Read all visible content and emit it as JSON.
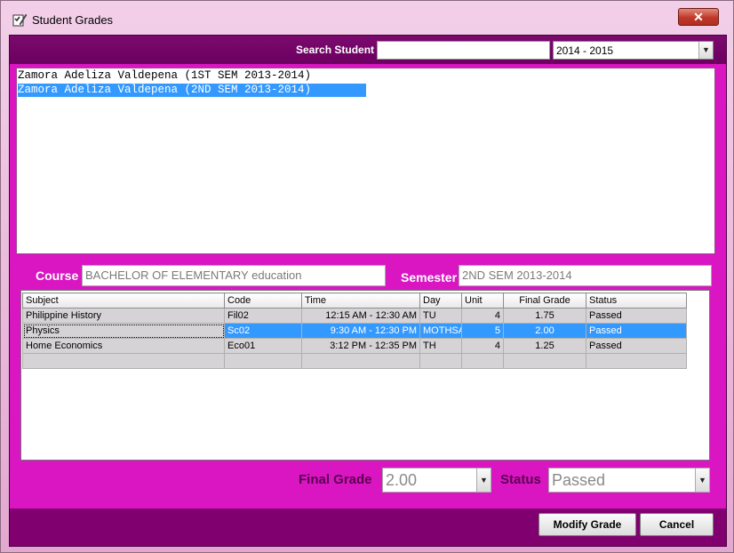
{
  "window": {
    "title": "Student Grades",
    "close_glyph": "✕",
    "app_icon": "checklist-pencil-icon"
  },
  "search": {
    "label": "Search Student",
    "value": "",
    "placeholder": ""
  },
  "year_select": {
    "selected": "2014 - 2015"
  },
  "student_list": {
    "items": [
      {
        "label": "Zamora Adeliza Valdepena (1ST SEM 2013-2014)",
        "selected": false
      },
      {
        "label": "Zamora Adeliza Valdepena (2ND SEM 2013-2014)",
        "selected": true
      }
    ]
  },
  "details": {
    "course_label": "Course",
    "course_value": "BACHELOR OF ELEMENTARY education",
    "semester_label": "Semester",
    "semester_value": "2ND SEM 2013-2014"
  },
  "grades_table": {
    "columns": [
      "Subject",
      "Code",
      "Time",
      "Day",
      "Unit",
      "Final Grade",
      "Status"
    ],
    "rows": [
      {
        "subject": "Philippine History",
        "code": "Fil02",
        "time": "12:15 AM - 12:30 AM",
        "day": "TU",
        "unit": "4",
        "final_grade": "1.75",
        "status": "Passed",
        "selected": false
      },
      {
        "subject": "Physics",
        "code": "Sc02",
        "time": "9:30 AM - 12:30 PM",
        "day": "MOTHSA",
        "unit": "5",
        "final_grade": "2.00",
        "status": "Passed",
        "selected": true
      },
      {
        "subject": "Home Economics",
        "code": "Eco01",
        "time": "3:12 PM - 12:35 PM",
        "day": "TH",
        "unit": "4",
        "final_grade": "1.25",
        "status": "Passed",
        "selected": false
      },
      {
        "subject": "",
        "code": "",
        "time": "",
        "day": "",
        "unit": "",
        "final_grade": "",
        "status": "",
        "selected": false
      }
    ]
  },
  "edit": {
    "final_grade_label": "Final Grade",
    "final_grade_value": "2.00",
    "status_label": "Status",
    "status_value": "Passed"
  },
  "buttons": {
    "modify_label": "Modify Grade",
    "cancel_label": "Cancel"
  },
  "colors": {
    "panel_dark": "#800070",
    "panel_bright": "#d916c2",
    "selection": "#3399ff"
  }
}
